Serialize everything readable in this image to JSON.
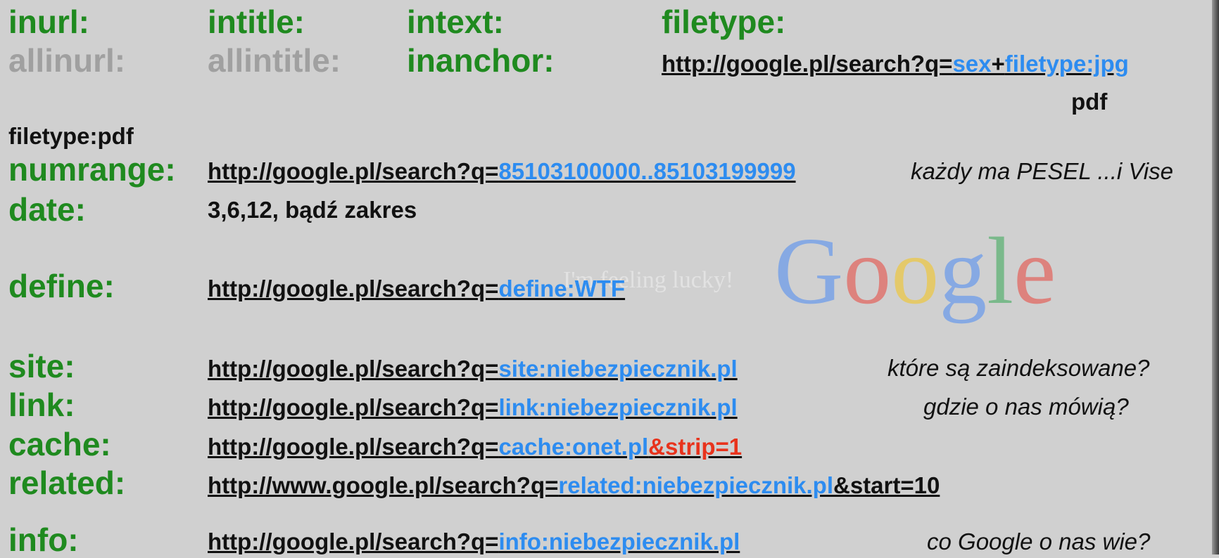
{
  "operators_row1": [
    "inurl:",
    "intitle:",
    "intext:",
    "filetype:"
  ],
  "operators_row2": [
    "allinurl:",
    "allintitle:",
    "inanchor:"
  ],
  "filetype_example": {
    "prefix": "http://google.pl/search?q=",
    "term": "sex",
    "plus": "+",
    "query": "filetype:jpg",
    "alt": "pdf"
  },
  "filetype_pdf": "filetype:pdf",
  "numrange": {
    "label": "numrange:",
    "prefix": "http://google.pl/search?q=",
    "query": "85103100000..85103199999",
    "note": "każdy ma PESEL ...i Vise"
  },
  "date": {
    "label": "date:",
    "text": "3,6,12, bądź zakres"
  },
  "define": {
    "label": "define:",
    "prefix": "http://google.pl/search?q=",
    "query": "define:WTF"
  },
  "site": {
    "label": "site:",
    "prefix": "http://google.pl/search?q=",
    "query": "site:niebezpiecznik.pl",
    "note": "które są zaindeksowane?"
  },
  "link": {
    "label": "link:",
    "prefix": "http://google.pl/search?q=",
    "query": "link:niebezpiecznik.pl",
    "note": "gdzie o nas mówią?"
  },
  "cache": {
    "label": "cache:",
    "prefix": "http://google.pl/search?q=",
    "query": "cache:onet.pl",
    "suffix": "&strip=1"
  },
  "related": {
    "label": "related:",
    "prefix": "http://www.google.pl/search?q=",
    "query": "related:niebezpiecznik.pl",
    "suffix": "&start=10"
  },
  "info": {
    "label": "info:",
    "prefix": "http://google.pl/search?q=",
    "query": "info:niebezpiecznik.pl",
    "note": "co Google o nas wie?"
  },
  "watermark": {
    "lucky_text": "I'm feeling lucky!",
    "google_letters": [
      "G",
      "o",
      "o",
      "g",
      "l",
      "e"
    ],
    "google_colors": [
      "#4a8af4",
      "#e8433b",
      "#f5c518",
      "#4a8af4",
      "#34a853",
      "#e8433b"
    ]
  },
  "colors": {
    "operator": "#1f8a1f",
    "operator_grey": "#a0a0a0",
    "link_blue": "#2d8cf0",
    "highlight_red": "#e8331c",
    "background": "#d0d0d0"
  }
}
